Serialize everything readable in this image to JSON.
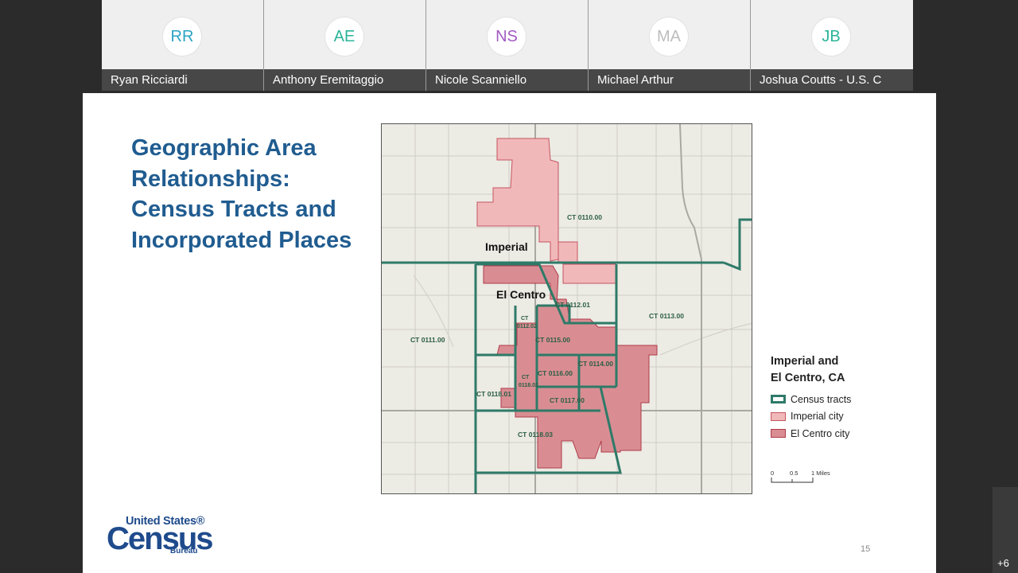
{
  "participants": [
    {
      "initials": "RR",
      "name": "Ryan Ricciardi",
      "color": "#2aa3c4"
    },
    {
      "initials": "AE",
      "name": "Anthony Eremitaggio",
      "color": "#2bb59a"
    },
    {
      "initials": "NS",
      "name": "Nicole Scanniello",
      "color": "#a25cc4"
    },
    {
      "initials": "MA",
      "name": "Michael Arthur",
      "color": "#bdbdbd"
    },
    {
      "initials": "JB",
      "name": "Joshua Coutts - U.S. C",
      "color": "#2bb59a"
    }
  ],
  "overflow_count": "+6",
  "slide": {
    "title": "Geographic Area Relationships: Census Tracts and Incorporated Places",
    "page_number": "15",
    "map": {
      "place_labels": {
        "imperial": "Imperial",
        "el_centro": "El Centro"
      },
      "tract_labels": {
        "ct0110": "CT 0110.00",
        "ct0112_01": "CT 0112.01",
        "ct0113": "CT 0113.00",
        "ct0111": "CT 0111.00",
        "ct_small_a": "CT",
        "ct0112_02": "0112.02",
        "ct0115": "CT 0115.00",
        "ct0114": "CT 0114.00",
        "ct_small_b": "CT",
        "ct0118_02": "0118.02",
        "ct0116": "CT 0116.00",
        "ct0118_01": "CT 0118.01",
        "ct0117": "CT 0117.00",
        "ct0118_03": "CT 0118.03"
      }
    },
    "legend": {
      "title": "Imperial and\nEl Centro, CA",
      "items": [
        {
          "label": "Census tracts"
        },
        {
          "label": "Imperial city"
        },
        {
          "label": "El Centro city"
        }
      ]
    },
    "scale": {
      "t0": "0",
      "t1": "0.5",
      "t2": "1 Miles"
    },
    "logo": {
      "line1": "United States®",
      "line2": "Census",
      "line3": "Bureau"
    },
    "colors": {
      "title": "#205c90",
      "tract": "#2e7a68",
      "imperial": "#f1b8ba",
      "el_centro": "#d98d92",
      "map_bg": "#ecebe4"
    }
  }
}
